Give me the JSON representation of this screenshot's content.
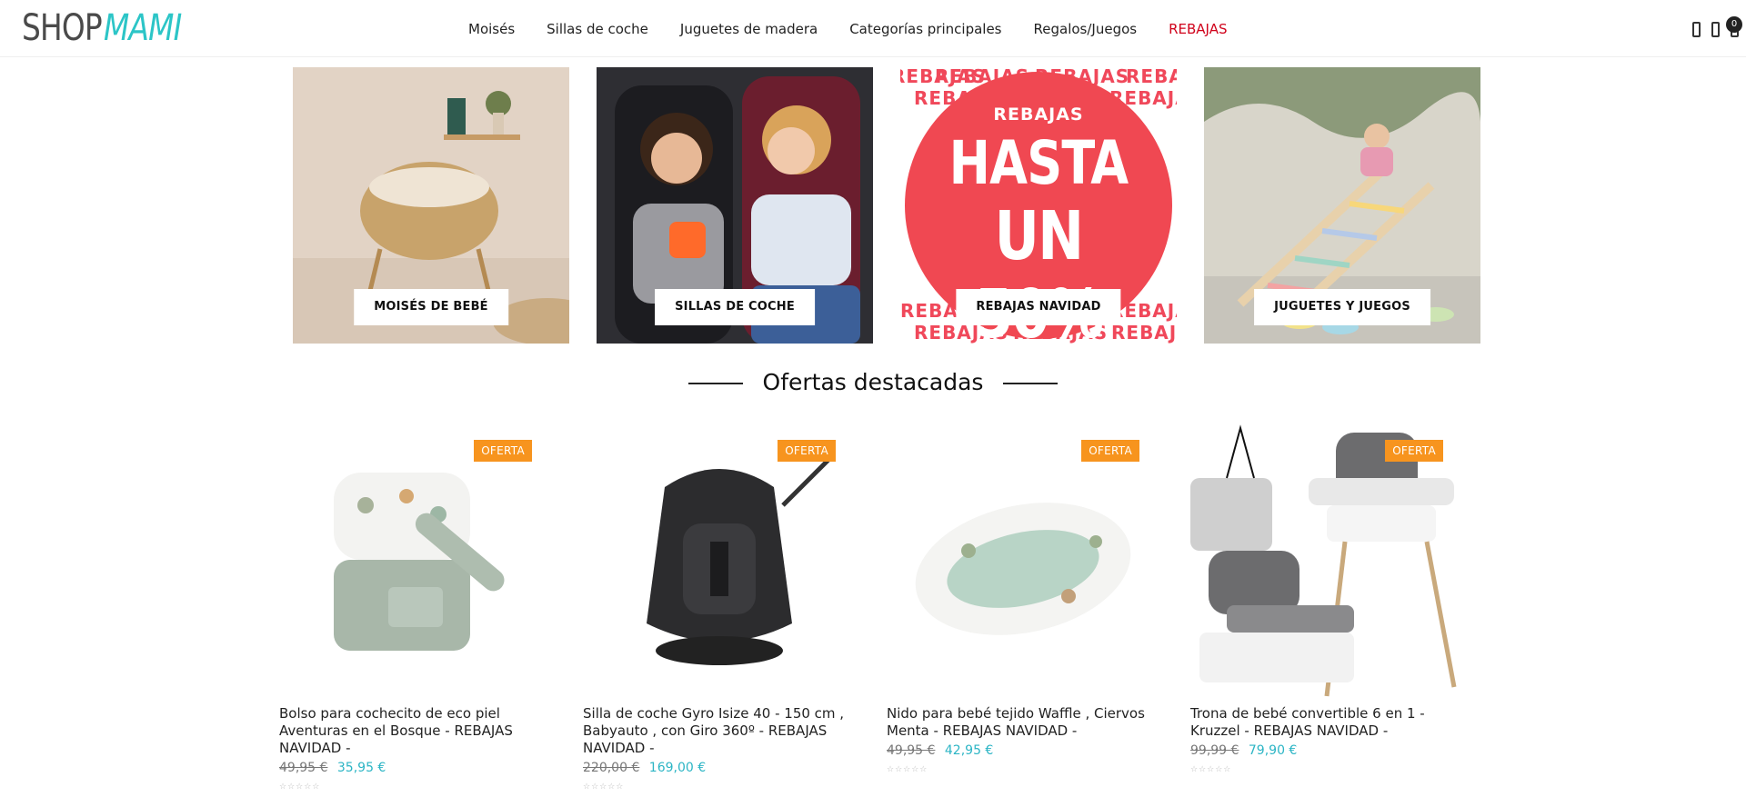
{
  "header": {
    "logo_left": "SHOP",
    "logo_right": "MAMI",
    "nav": [
      {
        "label": "Moisés"
      },
      {
        "label": "Sillas de coche"
      },
      {
        "label": "Juguetes de madera"
      },
      {
        "label": "Categorías principales"
      },
      {
        "label": "Regalos/Juegos"
      },
      {
        "label": "REBAJAS"
      }
    ],
    "cart_count": "0"
  },
  "categories": [
    {
      "label": "MOISÉS DE BEBÉ"
    },
    {
      "label": "SILLAS DE COCHE"
    },
    {
      "label": "REBAJAS NAVIDAD",
      "banner_small": "REBAJAS",
      "banner_line1": "HASTA",
      "banner_line2": "UN 50%",
      "repeat_text": "REBAJAS"
    },
    {
      "label": "JUGUETES Y JUEGOS"
    }
  ],
  "section": {
    "title": "Ofertas destacadas"
  },
  "products": [
    {
      "badge": "OFERTA",
      "title": "Bolso para cochecito de eco piel Aventuras en el Bosque - REBAJAS NAVIDAD -",
      "old_price": "49,95 €",
      "new_price": "35,95 €"
    },
    {
      "badge": "OFERTA",
      "title": "Silla de coche Gyro Isize 40 - 150 cm , Babyauto , con Giro 360º - REBAJAS NAVIDAD -",
      "old_price": "220,00 €",
      "new_price": "169,00 €"
    },
    {
      "badge": "OFERTA",
      "title": "Nido para bebé tejido Waffle , Ciervos Menta - REBAJAS NAVIDAD -",
      "old_price": "49,95 €",
      "new_price": "42,95 €"
    },
    {
      "badge": "OFERTA",
      "title": "Trona de bebé convertible 6 en 1 - Kruzzel - REBAJAS NAVIDAD -",
      "old_price": "99,99 €",
      "new_price": "79,90 €"
    }
  ],
  "colors": {
    "accent": "#2cc5c7",
    "sale_red": "#d0021b",
    "badge": "#f7941e",
    "price_new": "#2cb5c5"
  }
}
